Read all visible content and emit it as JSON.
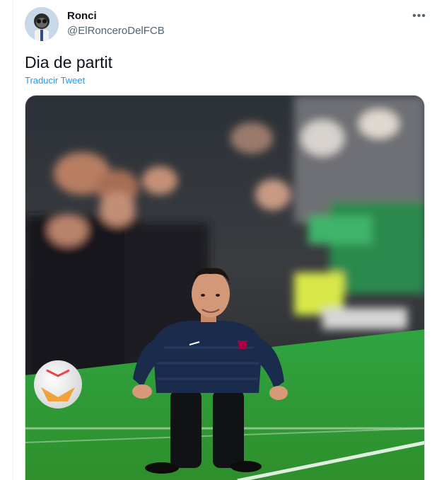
{
  "tweet": {
    "author_name": "Ronci",
    "author_handle": "@ElRonceroDelFCB",
    "text": "Dia de partit",
    "translate_link": "Traducir Tweet",
    "more_icon": "more-horizontal-icon"
  },
  "media": {
    "kind": "photo"
  },
  "colors": {
    "link": "#1d9bf0",
    "text": "#0f1419",
    "muted": "#536471",
    "border": "#cfd9de"
  }
}
